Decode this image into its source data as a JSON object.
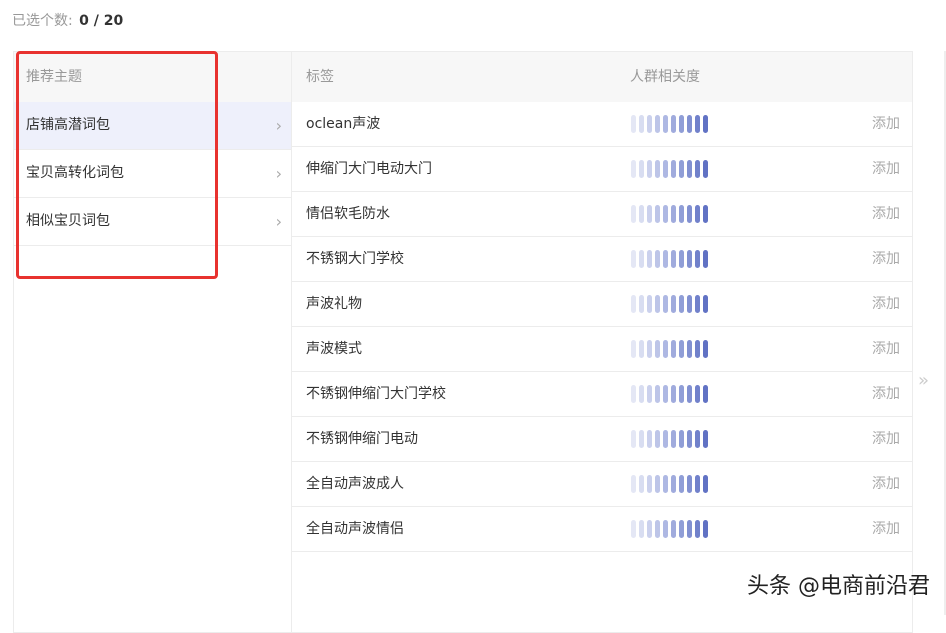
{
  "selection": {
    "label": "已选个数:",
    "value": "0 / 20"
  },
  "topics": {
    "header": "推荐主题",
    "items": [
      {
        "label": "店铺高潜词包",
        "active": true
      },
      {
        "label": "宝贝高转化词包",
        "active": false
      },
      {
        "label": "相似宝贝词包",
        "active": false
      }
    ],
    "chevron_icon": "chevron-right-icon"
  },
  "table": {
    "col_tag": "标签",
    "col_relevance": "人群相关度",
    "add_label": "添加",
    "rows": [
      {
        "tag": "oclean声波",
        "relevance": 10
      },
      {
        "tag": "伸缩门大门电动大门",
        "relevance": 10
      },
      {
        "tag": "情侣软毛防水",
        "relevance": 10
      },
      {
        "tag": "不锈钢大门学校",
        "relevance": 10
      },
      {
        "tag": "声波礼物",
        "relevance": 10
      },
      {
        "tag": "声波模式",
        "relevance": 10
      },
      {
        "tag": "不锈钢伸缩门大门学校",
        "relevance": 10
      },
      {
        "tag": "不锈钢伸缩门电动",
        "relevance": 10
      },
      {
        "tag": "全自动声波成人",
        "relevance": 10
      },
      {
        "tag": "全自动声波情侣",
        "relevance": 10
      }
    ]
  },
  "bar_colors": [
    "#e4e7f5",
    "#d8ddf1",
    "#cbd1ed",
    "#bdc5e8",
    "#aeb8e3",
    "#a0abdd",
    "#909ed7",
    "#8190d1",
    "#7181cb",
    "#6172c4"
  ],
  "accent_red": "#e8322f",
  "scroll_icon": "double-chevron-right-icon",
  "watermark": "头条 @电商前沿君"
}
